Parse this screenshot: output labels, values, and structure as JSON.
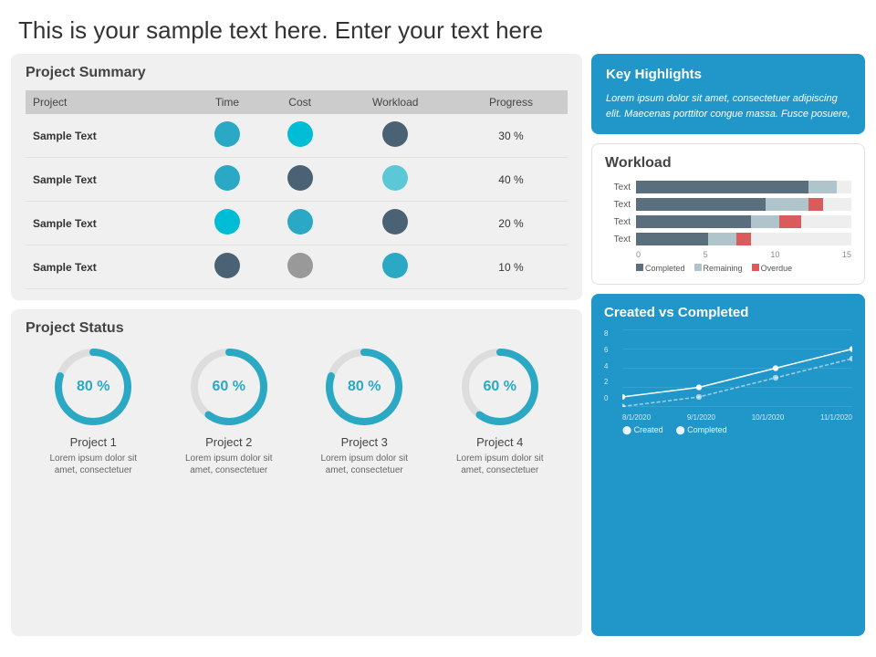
{
  "header": {
    "title": "This is your sample text here. Enter your text here"
  },
  "project_summary": {
    "title": "Project Summary",
    "columns": [
      "Project",
      "Time",
      "Cost",
      "Workload",
      "Progress"
    ],
    "rows": [
      {
        "name": "Sample Text",
        "time_color": "teal",
        "cost_color": "cyan",
        "workload_color": "dark",
        "progress": "30 %"
      },
      {
        "name": "Sample Text",
        "time_color": "teal",
        "cost_color": "dark",
        "workload_color": "light-blue",
        "progress": "40 %"
      },
      {
        "name": "Sample Text",
        "time_color": "cyan",
        "cost_color": "teal",
        "workload_color": "dark",
        "progress": "20 %"
      },
      {
        "name": "Sample Text",
        "time_color": "dark",
        "cost_color": "gray",
        "workload_color": "teal",
        "progress": "10 %"
      }
    ]
  },
  "project_status": {
    "title": "Project Status",
    "items": [
      {
        "name": "Project 1",
        "percent": "80 %",
        "value": 80,
        "desc": "Lorem ipsum dolor sit amet, consectetuer"
      },
      {
        "name": "Project 2",
        "percent": "60 %",
        "value": 60,
        "desc": "Lorem ipsum dolor sit amet, consectetuer"
      },
      {
        "name": "Project 3",
        "percent": "80 %",
        "value": 80,
        "desc": "Lorem ipsum dolor sit amet, consectetuer"
      },
      {
        "name": "Project 4",
        "percent": "60 %",
        "value": 60,
        "desc": "Lorem ipsum dolor sit amet, consectetuer"
      }
    ]
  },
  "key_highlights": {
    "title": "Key Highlights",
    "body": "Lorem ipsum dolor sit amet, consectetuer adipiscing elit. Maecenas porttitor congue massa. Fusce posuere,"
  },
  "workload": {
    "title": "Workload",
    "rows": [
      {
        "label": "Text",
        "completed": 12,
        "remaining": 2,
        "overdue": 0
      },
      {
        "label": "Text",
        "completed": 9,
        "remaining": 3,
        "overdue": 1
      },
      {
        "label": "Text",
        "completed": 8,
        "remaining": 2,
        "overdue": 1.5
      },
      {
        "label": "Text",
        "completed": 5,
        "remaining": 2,
        "overdue": 1
      }
    ],
    "axis": [
      "0",
      "5",
      "10",
      "15"
    ],
    "legend": [
      "Completed",
      "Remaining",
      "Overdue"
    ]
  },
  "created_vs_completed": {
    "title": "Created vs Completed",
    "y_labels": [
      "8",
      "6",
      "4",
      "2",
      "0"
    ],
    "x_labels": [
      "8/1/2020",
      "9/1/2020",
      "10/1/2020",
      "11/1/2020"
    ],
    "legend": [
      "Created",
      "Completed"
    ],
    "created_points": [
      1,
      2,
      4,
      6
    ],
    "completed_points": [
      0,
      1,
      3,
      5
    ]
  }
}
